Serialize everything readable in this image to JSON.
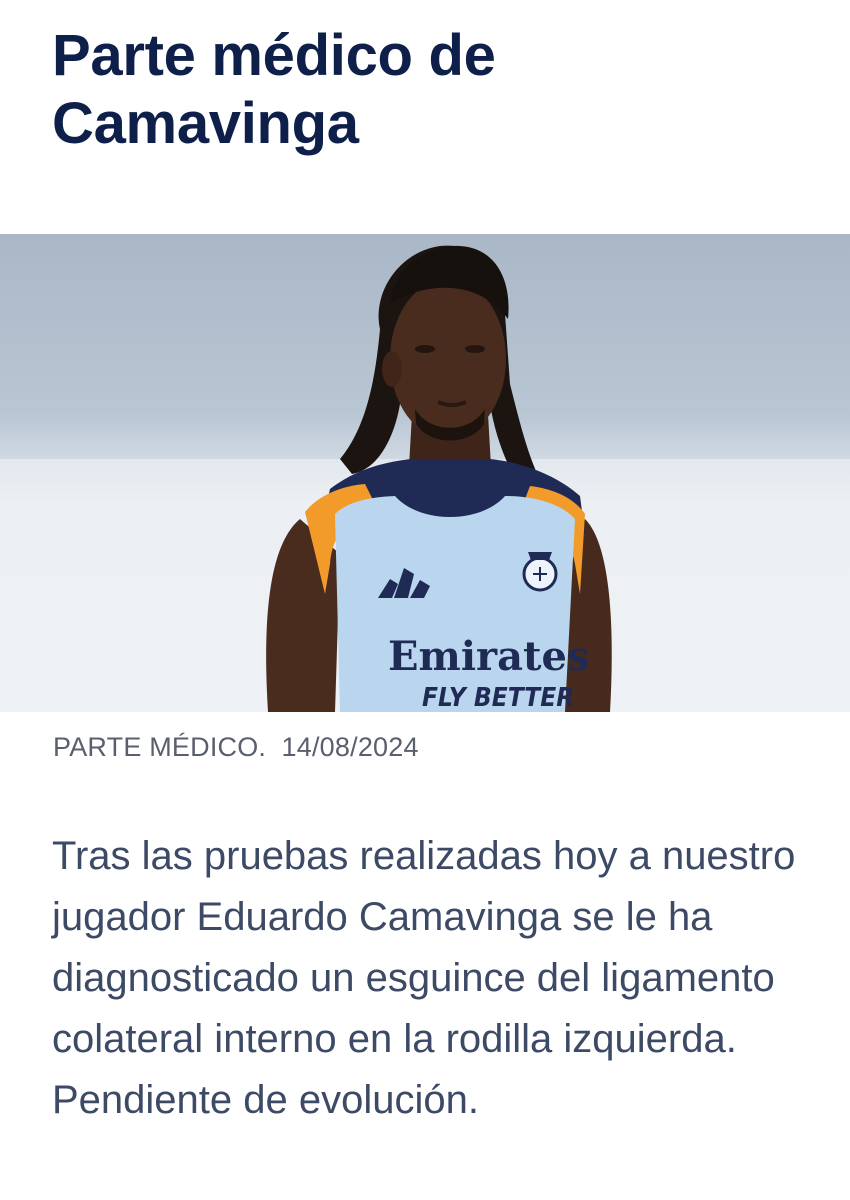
{
  "article": {
    "title": "Parte médico de Camavinga",
    "category": "PARTE MÉDICO.",
    "date": "14/08/2024",
    "body": "Tras las pruebas realizadas hoy a nuestro jugador Eduardo Camavinga se le ha diagnosticado un esguince del ligamento colateral interno en la rodilla izquierda. Pendiente de evolución."
  },
  "photo": {
    "sponsor_line1": "Emirates",
    "sponsor_line2": "FLY BETTER",
    "colors": {
      "sky": "#b3c1cf",
      "shirt": "#b9d6ee",
      "trim_orange": "#f29b2b",
      "trim_navy": "#1f2a55",
      "skin": "#4a2c1f"
    }
  }
}
